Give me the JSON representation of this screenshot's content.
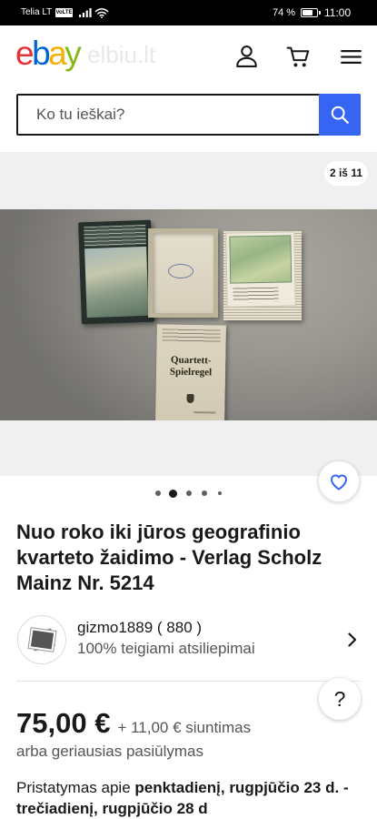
{
  "status_bar": {
    "carrier": "Telia LT",
    "network_badge": "VoLTE",
    "battery_text": "74 %",
    "battery_level": 0.74,
    "time": "11:00",
    "icons": [
      "signal-icon",
      "wifi-icon",
      "battery-icon"
    ]
  },
  "header": {
    "logo_letters": [
      "e",
      "b",
      "a",
      "y"
    ],
    "watermark": "elbiu.lt",
    "icons": [
      "user-icon",
      "cart-icon",
      "menu-icon"
    ]
  },
  "search": {
    "placeholder": "Ko tu ieškai?",
    "icon": "search-icon"
  },
  "gallery": {
    "counter": "2 iš 11",
    "pager": {
      "count": 5,
      "active": 2
    },
    "favorite_icon": "heart-icon",
    "photo": {
      "booklet_title": [
        "Quartett-",
        "Spielregel"
      ]
    }
  },
  "listing": {
    "title": "Nuo roko iki jūros geografinio kvarteto žaidimo - Verlag Scholz Mainz Nr. 5214",
    "seller": {
      "name": "gizmo1889",
      "feedback_count": "( 880 )",
      "feedback_rating": "100% teigiami atsiliepimai",
      "chevron_icon": "chevron-right-icon"
    },
    "price": "75,00 €",
    "shipping": "+ 11,00 € siuntimas",
    "best_offer": "arba geriausias pasiūlymas",
    "delivery": {
      "prefix": "Pristatymas apie",
      "dates": "penktadienį, rugpjūčio 23 d. - trečiadienį, rugpjūčio 28 d"
    }
  },
  "help_button": {
    "label": "?"
  },
  "colors": {
    "accent": "#3665f3",
    "text": "#191919",
    "muted": "#555555",
    "status_bar_bg": "#000000",
    "gallery_bg": "#f0f0f0",
    "logo": [
      "#e53238",
      "#0064d2",
      "#f5af02",
      "#86b817"
    ]
  }
}
